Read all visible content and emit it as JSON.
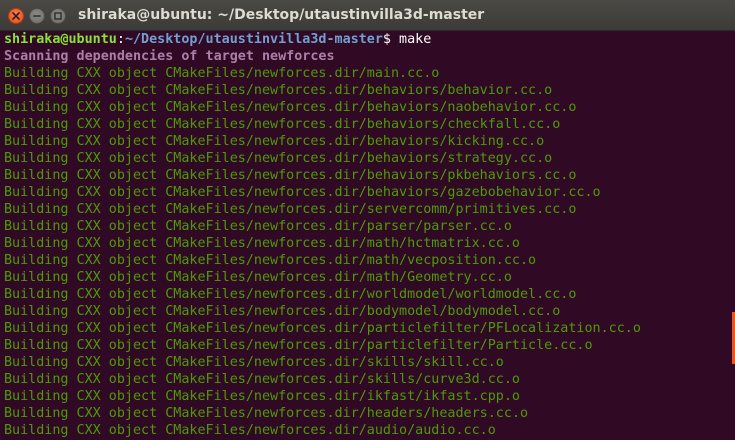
{
  "window": {
    "title": "shiraka@ubuntu: ~/Desktop/utaustinvilla3d-master",
    "buttons": [
      "close-icon",
      "minimize-icon",
      "maximize-icon"
    ]
  },
  "colors": {
    "background": "#300a24",
    "prompt_user": "#8ae234",
    "prompt_path": "#729fcf",
    "scan": "#ad7fa8",
    "build": "#4e9a06",
    "close_button": "#df4a16"
  },
  "terminal": {
    "prompt": {
      "user_host": "shiraka@ubuntu",
      "separator": ":",
      "path": "~/Desktop/utaustinvilla3d-master",
      "symbol": "$ ",
      "command": "make"
    },
    "scan_line": "Scanning dependencies of target newforces",
    "build_lines": [
      "Building CXX object CMakeFiles/newforces.dir/main.cc.o",
      "Building CXX object CMakeFiles/newforces.dir/behaviors/behavior.cc.o",
      "Building CXX object CMakeFiles/newforces.dir/behaviors/naobehavior.cc.o",
      "Building CXX object CMakeFiles/newforces.dir/behaviors/checkfall.cc.o",
      "Building CXX object CMakeFiles/newforces.dir/behaviors/kicking.cc.o",
      "Building CXX object CMakeFiles/newforces.dir/behaviors/strategy.cc.o",
      "Building CXX object CMakeFiles/newforces.dir/behaviors/pkbehaviors.cc.o",
      "Building CXX object CMakeFiles/newforces.dir/behaviors/gazebobehavior.cc.o",
      "Building CXX object CMakeFiles/newforces.dir/servercomm/primitives.cc.o",
      "Building CXX object CMakeFiles/newforces.dir/parser/parser.cc.o",
      "Building CXX object CMakeFiles/newforces.dir/math/hctmatrix.cc.o",
      "Building CXX object CMakeFiles/newforces.dir/math/vecposition.cc.o",
      "Building CXX object CMakeFiles/newforces.dir/math/Geometry.cc.o",
      "Building CXX object CMakeFiles/newforces.dir/worldmodel/worldmodel.cc.o",
      "Building CXX object CMakeFiles/newforces.dir/bodymodel/bodymodel.cc.o",
      "Building CXX object CMakeFiles/newforces.dir/particlefilter/PFLocalization.cc.o",
      "Building CXX object CMakeFiles/newforces.dir/particlefilter/Particle.cc.o",
      "Building CXX object CMakeFiles/newforces.dir/skills/skill.cc.o",
      "Building CXX object CMakeFiles/newforces.dir/skills/curve3d.cc.o",
      "Building CXX object CMakeFiles/newforces.dir/ikfast/ikfast.cpp.o",
      "Building CXX object CMakeFiles/newforces.dir/headers/headers.cc.o",
      "Building CXX object CMakeFiles/newforces.dir/audio/audio.cc.o"
    ]
  }
}
